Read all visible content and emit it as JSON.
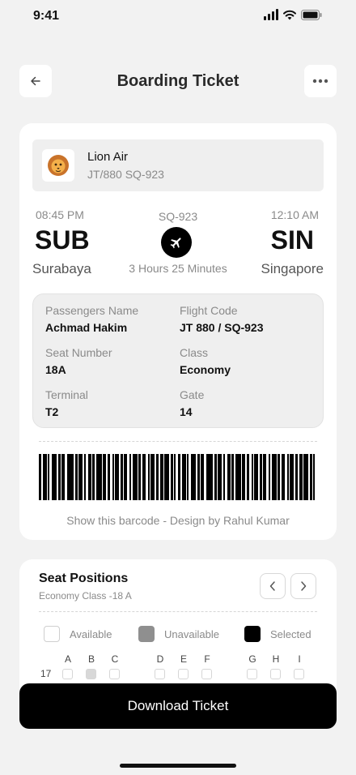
{
  "status_bar": {
    "time": "9:41",
    "icons": [
      "signal-icon",
      "wifi-icon",
      "battery-icon"
    ]
  },
  "header": {
    "title": "Boarding Ticket",
    "back_icon": "arrow-left-icon",
    "more_icon": "more-dots-icon"
  },
  "ticket": {
    "airline": {
      "name": "Lion Air",
      "code": "JT/880 SQ-923",
      "logo_icon": "lion-logo-icon"
    },
    "departure": {
      "time": "08:45 PM",
      "code": "SUB",
      "city": "Surabaya"
    },
    "arrival": {
      "time": "12:10 AM",
      "code": "SIN",
      "city": "Singapore"
    },
    "flight_number": "SQ-923",
    "duration": "3 Hours 25 Minutes",
    "details": [
      {
        "label": "Passengers Name",
        "value": "Achmad Hakim"
      },
      {
        "label": "Flight Code",
        "value": "JT 880 / SQ-923"
      },
      {
        "label": "Seat Number",
        "value": "18A"
      },
      {
        "label": "Class",
        "value": "Economy"
      },
      {
        "label": "Terminal",
        "value": "T2"
      },
      {
        "label": "Gate",
        "value": "14"
      }
    ],
    "barcode_caption": "Show this barcode - Design by Rahul Kumar"
  },
  "seats": {
    "title": "Seat Positions",
    "subtitle": "Economy Class -18 A",
    "legend": [
      {
        "label": "Available",
        "color": "#ffffff"
      },
      {
        "label": "Unavailable",
        "color": "#8f8f8f"
      },
      {
        "label": "Selected",
        "color": "#000000"
      }
    ],
    "columns": [
      "A",
      "B",
      "C",
      "D",
      "E",
      "F",
      "G",
      "H",
      "I"
    ],
    "rows": [
      {
        "number": "17",
        "unavailable": [
          "B"
        ]
      }
    ]
  },
  "download_button": {
    "label": "Download Ticket"
  }
}
